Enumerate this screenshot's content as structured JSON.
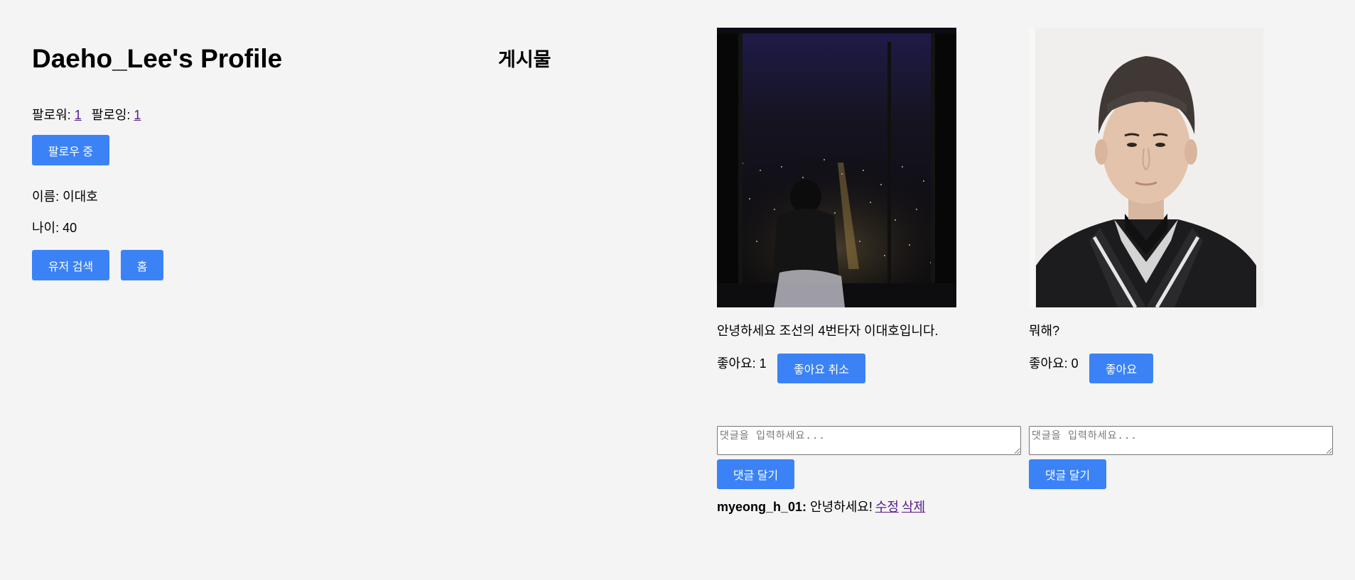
{
  "profile": {
    "title": "Daeho_Lee's Profile",
    "followers_label": "팔로워: ",
    "followers_count": "1",
    "following_label": "팔로잉: ",
    "following_count": "1",
    "follow_button": "팔로우 중",
    "name_line": "이름: 이대호",
    "age_line": "나이: 40",
    "search_button": "유저 검색",
    "home_button": "홈"
  },
  "posts_heading": "게시물",
  "posts": [
    {
      "caption": "안녕하세요 조선의 4번타자 이대호입니다.",
      "likes_text": "좋아요: 1",
      "like_button": "좋아요 취소",
      "comment_placeholder": "댓글을 입력하세요...",
      "comment_button": "댓글 달기",
      "comments": [
        {
          "author": "myeong_h_01:",
          "text": " 안녕하세요!",
          "edit": "수정",
          "delete": "삭제"
        }
      ]
    },
    {
      "caption": "뭐해?",
      "likes_text": "좋아요: 0",
      "like_button": "좋아요",
      "comment_placeholder": "댓글을 입력하세요...",
      "comment_button": "댓글 달기",
      "comments": []
    }
  ],
  "colors": {
    "background": "#f4f4f4",
    "button": "#3b82f6",
    "link": "#551a8b"
  }
}
